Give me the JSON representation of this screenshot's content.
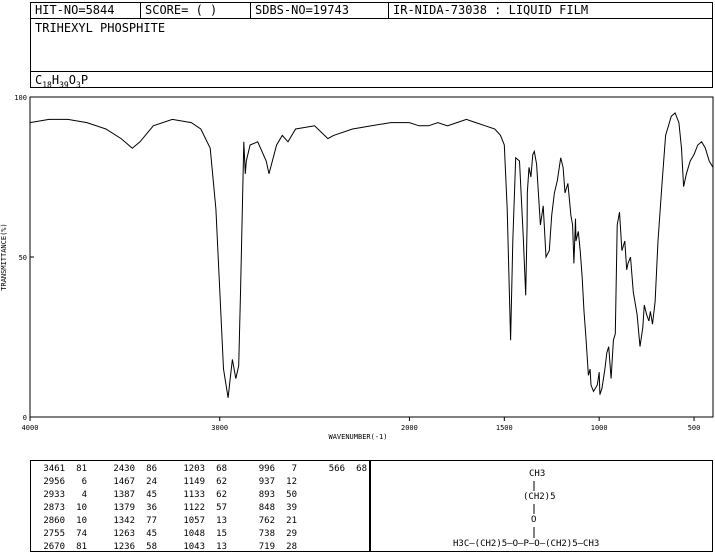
{
  "header": {
    "hit_no": "HIT-NO=5844",
    "score": "SCORE=  (   )",
    "sdbs_no": "SDBS-NO=19743",
    "ir_info": "IR-NIDA-73038 : LIQUID FILM",
    "compound": "TRIHEXYL PHOSPHITE",
    "formula_parts": [
      "C",
      "18",
      "H",
      "39",
      "O",
      "3",
      "P"
    ]
  },
  "chart_data": {
    "type": "line",
    "xlabel": "WAVENUMBER(-1)",
    "ylabel": "TRANSMITTANCE(%)",
    "xlim": [
      4000,
      400
    ],
    "ylim": [
      0,
      100
    ],
    "x_ticks": [
      "4000",
      "3000",
      "2000",
      "1500",
      "1000",
      "500"
    ],
    "x_tick_values": [
      4000,
      3000,
      2000,
      1500,
      1000,
      500
    ],
    "y_ticks": [
      "0",
      "50",
      "100"
    ],
    "y_tick_values": [
      0,
      50,
      100
    ],
    "grid": false,
    "series": [
      {
        "x": [
          4000,
          3900,
          3800,
          3700,
          3600,
          3520,
          3461,
          3420,
          3350,
          3250,
          3150,
          3100,
          3050,
          3020,
          3000,
          2980,
          2956,
          2945,
          2933,
          2915,
          2900,
          2890,
          2873,
          2865,
          2860,
          2840,
          2800,
          2755,
          2740,
          2700,
          2670,
          2640,
          2600,
          2500,
          2430,
          2400,
          2300,
          2200,
          2100,
          2000,
          1950,
          1900,
          1850,
          1800,
          1750,
          1700,
          1650,
          1600,
          1550,
          1520,
          1500,
          1485,
          1467,
          1455,
          1440,
          1420,
          1400,
          1387,
          1380,
          1379,
          1370,
          1360,
          1350,
          1342,
          1330,
          1310,
          1295,
          1280,
          1263,
          1250,
          1236,
          1220,
          1203,
          1190,
          1180,
          1165,
          1149,
          1140,
          1133,
          1125,
          1122,
          1110,
          1100,
          1090,
          1080,
          1070,
          1057,
          1048,
          1043,
          1030,
          1010,
          1000,
          996,
          985,
          970,
          960,
          950,
          937,
          925,
          915,
          905,
          893,
          880,
          865,
          855,
          848,
          835,
          820,
          800,
          785,
          770,
          762,
          750,
          738,
          730,
          719,
          705,
          690,
          670,
          650,
          620,
          600,
          580,
          566,
          555,
          540,
          520,
          500,
          480,
          460,
          440,
          420,
          400
        ],
        "y": [
          92,
          93,
          93,
          92,
          90,
          87,
          84,
          86,
          91,
          93,
          92,
          90,
          84,
          65,
          40,
          15,
          6,
          12,
          18,
          12,
          16,
          40,
          86,
          76,
          80,
          85,
          86,
          80,
          76,
          85,
          88,
          86,
          90,
          91,
          87,
          88,
          90,
          91,
          92,
          92,
          91,
          91,
          92,
          91,
          92,
          93,
          92,
          91,
          90,
          88,
          85,
          65,
          24,
          55,
          81,
          80,
          56,
          38,
          60,
          70,
          78,
          75,
          82,
          83,
          79,
          60,
          66,
          50,
          52,
          63,
          70,
          74,
          81,
          78,
          70,
          73,
          63,
          60,
          48,
          62,
          55,
          58,
          52,
          44,
          33,
          25,
          13,
          15,
          10,
          8,
          10,
          14,
          7,
          9,
          15,
          20,
          22,
          12,
          24,
          26,
          60,
          64,
          52,
          55,
          46,
          48,
          50,
          39,
          32,
          22,
          28,
          35,
          32,
          30,
          33,
          29,
          36,
          55,
          72,
          88,
          94,
          95,
          92,
          84,
          72,
          76,
          80,
          82,
          85,
          86,
          84,
          80,
          78
        ]
      }
    ]
  },
  "peak_table": [
    [
      [
        "3461",
        "81"
      ],
      [
        "2956",
        "6"
      ],
      [
        "2933",
        "4"
      ],
      [
        "2873",
        "10"
      ],
      [
        "2860",
        "10"
      ],
      [
        "2755",
        "74"
      ],
      [
        "2670",
        "81"
      ]
    ],
    [
      [
        "2430",
        "86"
      ],
      [
        "1467",
        "24"
      ],
      [
        "1387",
        "45"
      ],
      [
        "1379",
        "36"
      ],
      [
        "1342",
        "77"
      ],
      [
        "1263",
        "45"
      ],
      [
        "1236",
        "58"
      ]
    ],
    [
      [
        "1203",
        "68"
      ],
      [
        "1149",
        "62"
      ],
      [
        "1133",
        "62"
      ],
      [
        "1122",
        "57"
      ],
      [
        "1057",
        "13"
      ],
      [
        "1048",
        "15"
      ],
      [
        "1043",
        "13"
      ]
    ],
    [
      [
        "996",
        "7"
      ],
      [
        "937",
        "12"
      ],
      [
        "893",
        "50"
      ],
      [
        "848",
        "39"
      ],
      [
        "762",
        "21"
      ],
      [
        "738",
        "29"
      ],
      [
        "719",
        "28"
      ]
    ],
    [
      [
        "566",
        "68"
      ]
    ]
  ],
  "structure": {
    "ch3_top": "CH3",
    "chain_top": "(CH2)5",
    "o_top": "O",
    "bottom_row": "H3C—(CH2)5—O—P—O—(CH2)5—CH3"
  }
}
